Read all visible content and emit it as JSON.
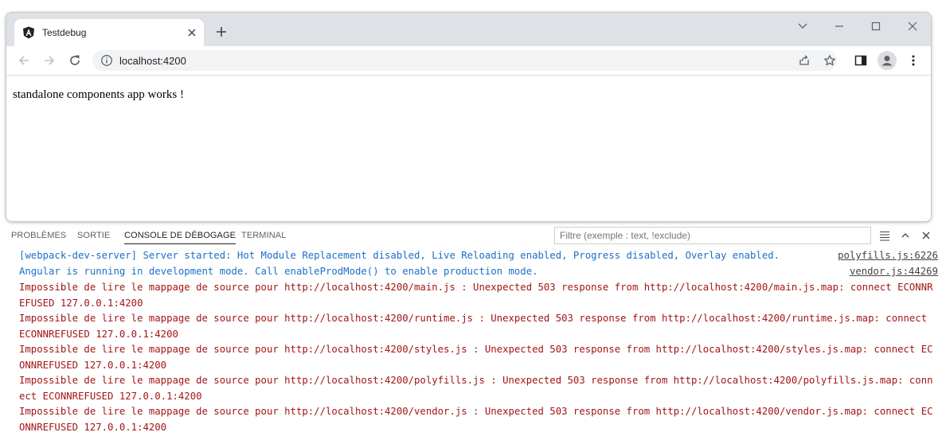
{
  "browser": {
    "tab_title": "Testdebug",
    "url": "localhost:4200",
    "page_text": "standalone components app works !"
  },
  "panel": {
    "tabs": [
      "PROBLÈMES",
      "SORTIE",
      "CONSOLE DE DÉBOGAGE",
      "TERMINAL"
    ],
    "active_tab": "CONSOLE DE DÉBOGAGE",
    "filter_placeholder": "Filtre (exemple : text, !exclude)"
  },
  "console": {
    "messages": [
      {
        "text": "[webpack-dev-server] Server started: Hot Module Replacement disabled, Live Reloading enabled, Progress disabled, Overlay enabled.",
        "source": "polyfills.js:6226",
        "level": "info"
      },
      {
        "text": "Angular is running in development mode. Call enableProdMode() to enable production mode.",
        "source": "vendor.js:44269",
        "level": "info"
      },
      {
        "text": "Impossible de lire le mappage de source pour http://localhost:4200/main.js : Unexpected 503 response from http://localhost:4200/main.js.map: connect ECONNREFUSED 127.0.0.1:4200",
        "level": "error"
      },
      {
        "text": "Impossible de lire le mappage de source pour http://localhost:4200/runtime.js : Unexpected 503 response from http://localhost:4200/runtime.js.map: connect ECONNREFUSED 127.0.0.1:4200",
        "level": "error"
      },
      {
        "text": "Impossible de lire le mappage de source pour http://localhost:4200/styles.js : Unexpected 503 response from http://localhost:4200/styles.js.map: connect ECONNREFUSED 127.0.0.1:4200",
        "level": "error"
      },
      {
        "text": "Impossible de lire le mappage de source pour http://localhost:4200/polyfills.js : Unexpected 503 response from http://localhost:4200/polyfills.js.map: connect ECONNREFUSED 127.0.0.1:4200",
        "level": "error"
      },
      {
        "text": "Impossible de lire le mappage de source pour http://localhost:4200/vendor.js : Unexpected 503 response from http://localhost:4200/vendor.js.map: connect ECONNREFUSED 127.0.0.1:4200",
        "level": "error"
      }
    ]
  },
  "colors": {
    "info": "#1a6fc8",
    "error": "#a31515"
  }
}
